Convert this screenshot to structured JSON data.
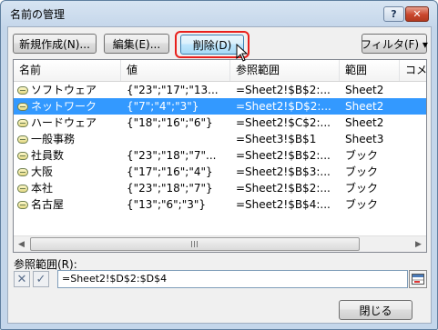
{
  "window": {
    "title": "名前の管理",
    "help_label": "?",
    "close_label": "✕"
  },
  "toolbar": {
    "new_label": "新規作成(N)...",
    "edit_label": "編集(E)...",
    "delete_label": "削除(D)",
    "filter_label": "フィルタ(F) ▾"
  },
  "table": {
    "columns": [
      "名前",
      "値",
      "参照範囲",
      "範囲",
      "コメ"
    ],
    "rows": [
      {
        "name": "ソフトウェア",
        "value": "{\"23\";\"17\";\"13...",
        "ref": "=Sheet2!$B$2:...",
        "scope": "Sheet2",
        "selected": false
      },
      {
        "name": "ネットワーク",
        "value": "{\"7\";\"4\";\"3\"}",
        "ref": "=Sheet2!$D$2:...",
        "scope": "Sheet2",
        "selected": true
      },
      {
        "name": "ハードウェア",
        "value": "{\"18\";\"16\";\"6\"}",
        "ref": "=Sheet2!$C$2:...",
        "scope": "Sheet2",
        "selected": false
      },
      {
        "name": "一般事務",
        "value": "",
        "ref": "=Sheet3!$B$1",
        "scope": "Sheet3",
        "selected": false
      },
      {
        "name": "社員数",
        "value": "{\"23\";\"18\";\"7\"...",
        "ref": "=Sheet2!$B$2:...",
        "scope": "ブック",
        "selected": false
      },
      {
        "name": "大阪",
        "value": "{\"17\";\"16\";\"4\"}",
        "ref": "=Sheet2!$B$3:...",
        "scope": "ブック",
        "selected": false
      },
      {
        "name": "本社",
        "value": "{\"23\";\"18\";\"7\"}",
        "ref": "=Sheet2!$B$2:...",
        "scope": "ブック",
        "selected": false
      },
      {
        "name": "名古屋",
        "value": "{\"13\";\"6\";\"3\"}",
        "ref": "=Sheet2!$B$4:...",
        "scope": "ブック",
        "selected": false
      }
    ]
  },
  "reference": {
    "label": "参照範囲(R):",
    "value": "=Sheet2!$D$2:$D$4"
  },
  "footer": {
    "close_label": "閉じる"
  },
  "colors": {
    "selection": "#3399ff",
    "highlight": "#e8201c"
  }
}
